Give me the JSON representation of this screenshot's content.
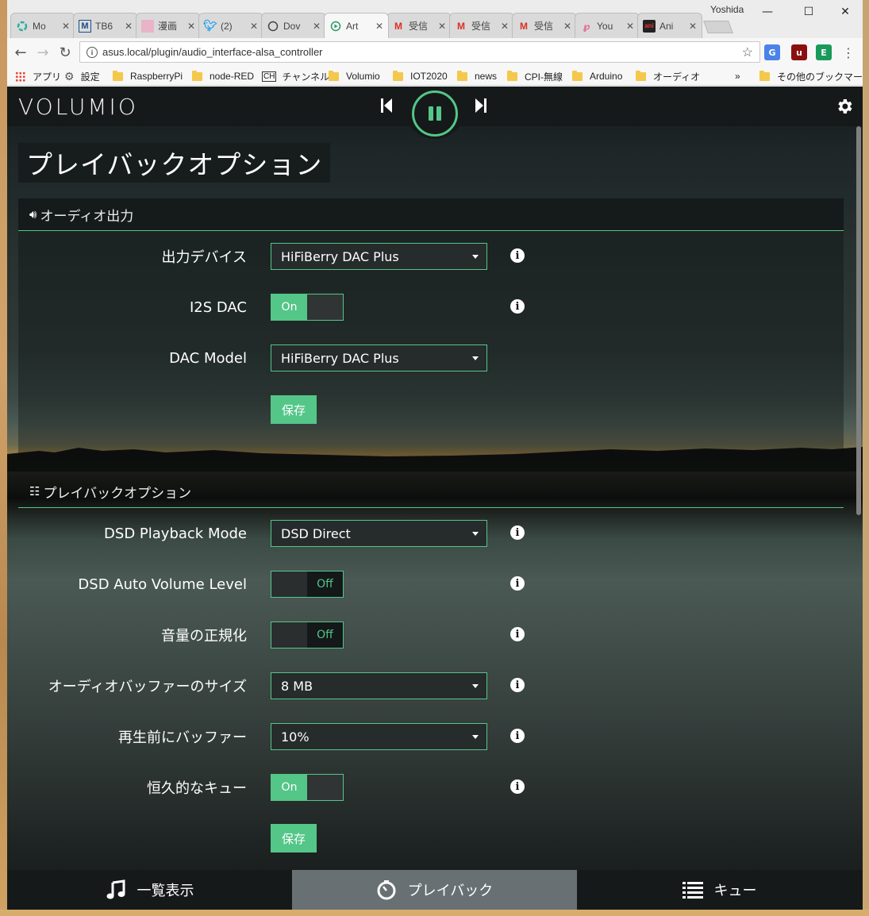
{
  "browser": {
    "profile_name": "Yoshida",
    "tabs": [
      {
        "title": "Mo",
        "icon": "circle-icon"
      },
      {
        "title": "TB6",
        "icon": "m-icon"
      },
      {
        "title": "漫画",
        "icon": "manga-icon"
      },
      {
        "title": "(2)",
        "icon": "twitter-icon"
      },
      {
        "title": "Dov",
        "icon": "circle-outline-icon"
      },
      {
        "title": "Art",
        "icon": "play-circle-icon"
      },
      {
        "title": "受信",
        "icon": "gmail-icon"
      },
      {
        "title": "受信",
        "icon": "gmail-icon"
      },
      {
        "title": "受信",
        "icon": "gmail-icon"
      },
      {
        "title": "You",
        "icon": "link-icon"
      },
      {
        "title": "Ani",
        "icon": "ani-icon"
      }
    ],
    "url": "asus.local/plugin/audio_interface-alsa_controller",
    "bookmarks": [
      {
        "label": "アプリ"
      },
      {
        "label": "設定"
      },
      {
        "label": "RaspberryPi"
      },
      {
        "label": "node-RED"
      },
      {
        "label": "チャンネル"
      },
      {
        "label": "Volumio"
      },
      {
        "label": "IOT2020"
      },
      {
        "label": "news"
      },
      {
        "label": "CPI-無線"
      },
      {
        "label": "Arduino"
      },
      {
        "label": "オーディオ"
      }
    ],
    "bookmarks_overflow": "»",
    "other_bookmarks": "その他のブックマーク"
  },
  "app": {
    "logo": "VOLUMIO",
    "page_title": "プレイバックオプション",
    "sections": [
      {
        "title": "オーディオ出力",
        "icon": "speaker-icon",
        "rows": [
          {
            "label": "出力デバイス",
            "type": "select",
            "value": "HiFiBerry DAC Plus",
            "info": true
          },
          {
            "label": "I2S DAC",
            "type": "toggle",
            "value": "On",
            "info": true
          },
          {
            "label": "DAC Model",
            "type": "select",
            "value": "HiFiBerry DAC Plus",
            "info": false
          }
        ],
        "save_label": "保存"
      },
      {
        "title": "プレイバックオプション",
        "icon": "sliders-icon",
        "rows": [
          {
            "label": "DSD Playback Mode",
            "type": "select",
            "value": "DSD Direct",
            "info": true
          },
          {
            "label": "DSD Auto Volume Level",
            "type": "toggle",
            "value": "Off",
            "info": true
          },
          {
            "label": "音量の正規化",
            "type": "toggle",
            "value": "Off",
            "info": true
          },
          {
            "label": "オーディオバッファーのサイズ",
            "type": "select",
            "value": "8 MB",
            "info": true
          },
          {
            "label": "再生前にバッファー",
            "type": "select",
            "value": "10%",
            "info": true
          },
          {
            "label": "恒久的なキュー",
            "type": "toggle",
            "value": "On",
            "info": true
          }
        ],
        "save_label": "保存"
      }
    ],
    "footer": [
      {
        "label": "一覧表示",
        "icon": "music-note-icon"
      },
      {
        "label": "プレイバック",
        "icon": "clock-icon",
        "active": true
      },
      {
        "label": "キュー",
        "icon": "list-icon"
      }
    ],
    "accent_color": "#54c688"
  }
}
